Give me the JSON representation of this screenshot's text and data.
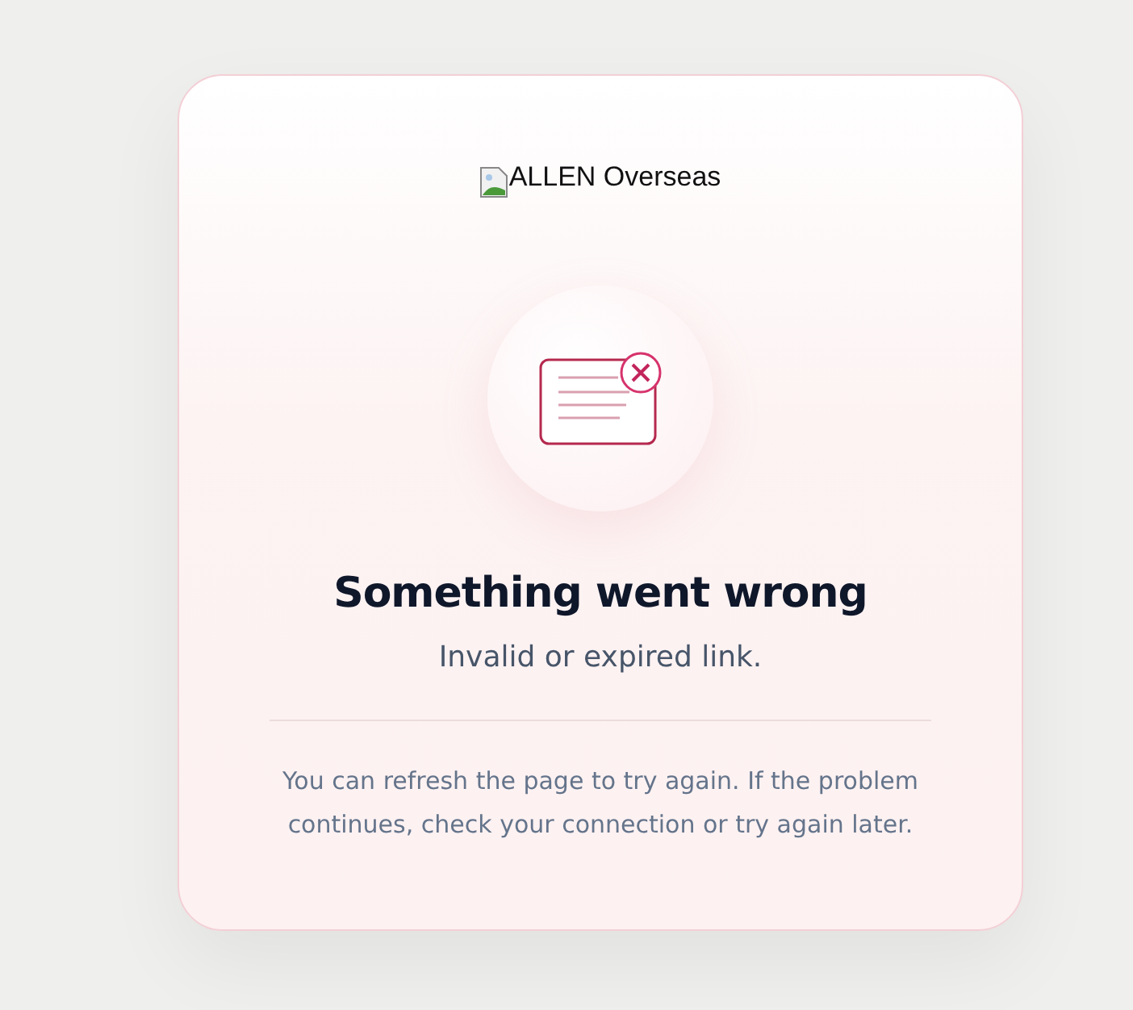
{
  "logo": {
    "alt_text": "ALLEN Overseas"
  },
  "error": {
    "title": "Something went wrong",
    "message": "Invalid or expired link.",
    "help": "You can refresh the page to try again. If the problem continues, check your connection or try again later."
  }
}
